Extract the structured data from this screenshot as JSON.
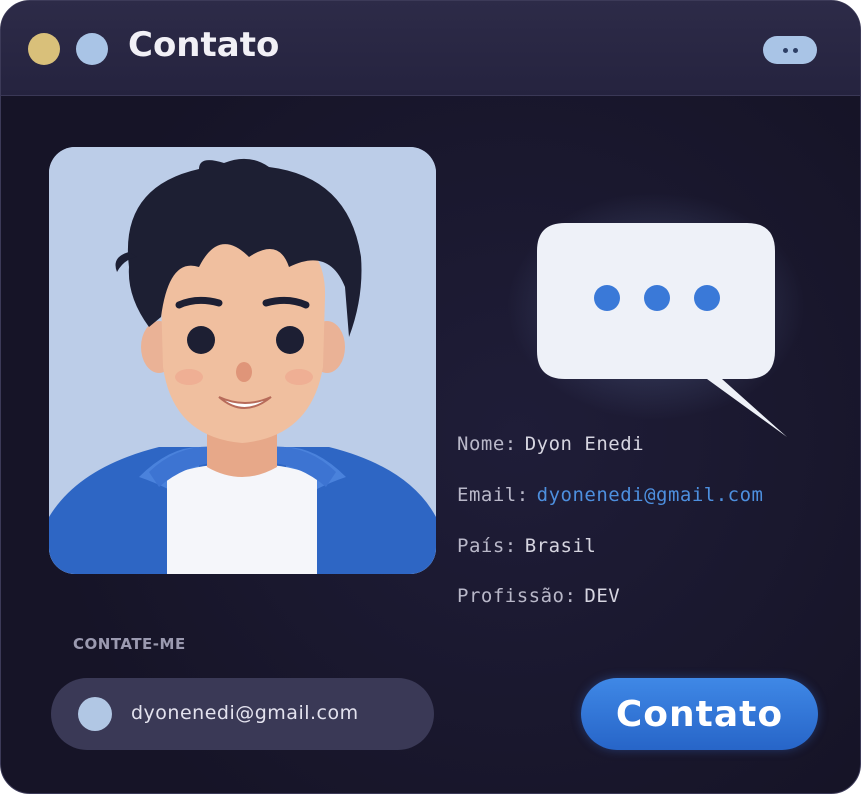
{
  "window": {
    "title": "Contato",
    "menu_icon": "more-horizontal-icon"
  },
  "profile": {
    "avatar_icon": "avatar-illustration",
    "chat_icon": "chat-bubble-icon",
    "fields": {
      "nome_label": "Nome:",
      "nome_value": "Dyon Enedi",
      "email_label": "Email:",
      "email_value": "dyonenedi@gmail.com",
      "pais_label": "País:",
      "pais_value": "Brasil",
      "profissao_label": "Profissão:",
      "profissao_value": "DEV"
    }
  },
  "contact": {
    "section_label": "CONTATE-ME",
    "email_value": "dyonenedi@gmail.com",
    "button_label": "Contato"
  },
  "colors": {
    "background": "#1a1830",
    "accent": "#2f73d6",
    "link": "#4d8fde",
    "dot_yellow": "#d9c07a",
    "dot_blue": "#a9c4e6"
  }
}
